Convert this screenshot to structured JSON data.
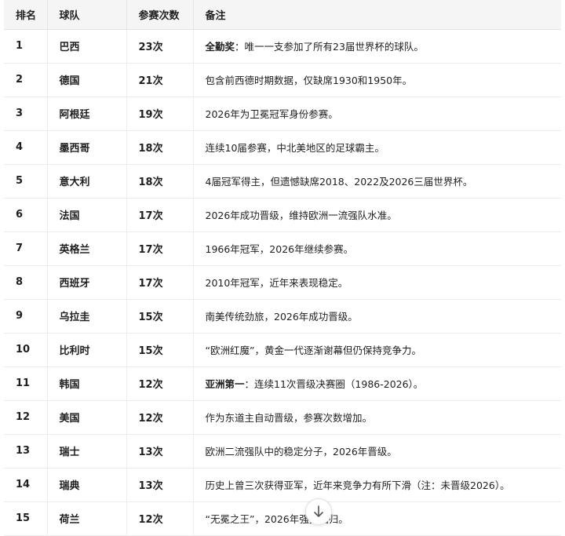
{
  "table": {
    "headers": [
      "排名",
      "球队",
      "参赛次数",
      "备注"
    ],
    "rows": [
      {
        "rank": "1",
        "team": "巴西",
        "count": "23次",
        "note_lead": "全勤奖",
        "note": "：唯一一支参加了所有23届世界杯的球队。"
      },
      {
        "rank": "2",
        "team": "德国",
        "count": "21次",
        "note_lead": "",
        "note": "包含前西德时期数据，仅缺席1930和1950年。"
      },
      {
        "rank": "3",
        "team": "阿根廷",
        "count": "19次",
        "note_lead": "",
        "note": "2026年为卫冕冠军身份参赛。"
      },
      {
        "rank": "4",
        "team": "墨西哥",
        "count": "18次",
        "note_lead": "",
        "note": "连续10届参赛，中北美地区的足球霸主。"
      },
      {
        "rank": "5",
        "team": "意大利",
        "count": "18次",
        "note_lead": "",
        "note": "4届冠军得主，但遗憾缺席2018、2022及2026三届世界杯。"
      },
      {
        "rank": "6",
        "team": "法国",
        "count": "17次",
        "note_lead": "",
        "note": "2026年成功晋级，维持欧洲一流强队水准。"
      },
      {
        "rank": "7",
        "team": "英格兰",
        "count": "17次",
        "note_lead": "",
        "note": "1966年冠军，2026年继续参赛。"
      },
      {
        "rank": "8",
        "team": "西班牙",
        "count": "17次",
        "note_lead": "",
        "note": "2010年冠军，近年来表现稳定。"
      },
      {
        "rank": "9",
        "team": "乌拉圭",
        "count": "15次",
        "note_lead": "",
        "note": "南美传统劲旅，2026年成功晋级。"
      },
      {
        "rank": "10",
        "team": "比利时",
        "count": "15次",
        "note_lead": "",
        "note": "“欧洲红魔”，黄金一代逐渐谢幕但仍保持竞争力。"
      },
      {
        "rank": "11",
        "team": "韩国",
        "count": "12次",
        "note_lead": "亚洲第一",
        "note": "：连续11次晋级决赛圈（1986-2026）。"
      },
      {
        "rank": "12",
        "team": "美国",
        "count": "12次",
        "note_lead": "",
        "note": "作为东道主自动晋级，参赛次数增加。"
      },
      {
        "rank": "13",
        "team": "瑞士",
        "count": "13次",
        "note_lead": "",
        "note": "欧洲二流强队中的稳定分子，2026年晋级。"
      },
      {
        "rank": "14",
        "team": "瑞典",
        "count": "13次",
        "note_lead": "",
        "note": "历史上曾三次获得亚军，近年来竞争力有所下滑（注：未晋级2026）。"
      },
      {
        "rank": "15",
        "team": "荷兰",
        "count": "12次",
        "note_lead": "",
        "note": "“无冕之王”，2026年强势回归。"
      }
    ]
  },
  "scroll_button": {
    "icon": "arrow-down-icon"
  },
  "colors": {
    "header_bg": "#f5f5f5",
    "border": "#ececec",
    "text": "#1f1f1f"
  }
}
